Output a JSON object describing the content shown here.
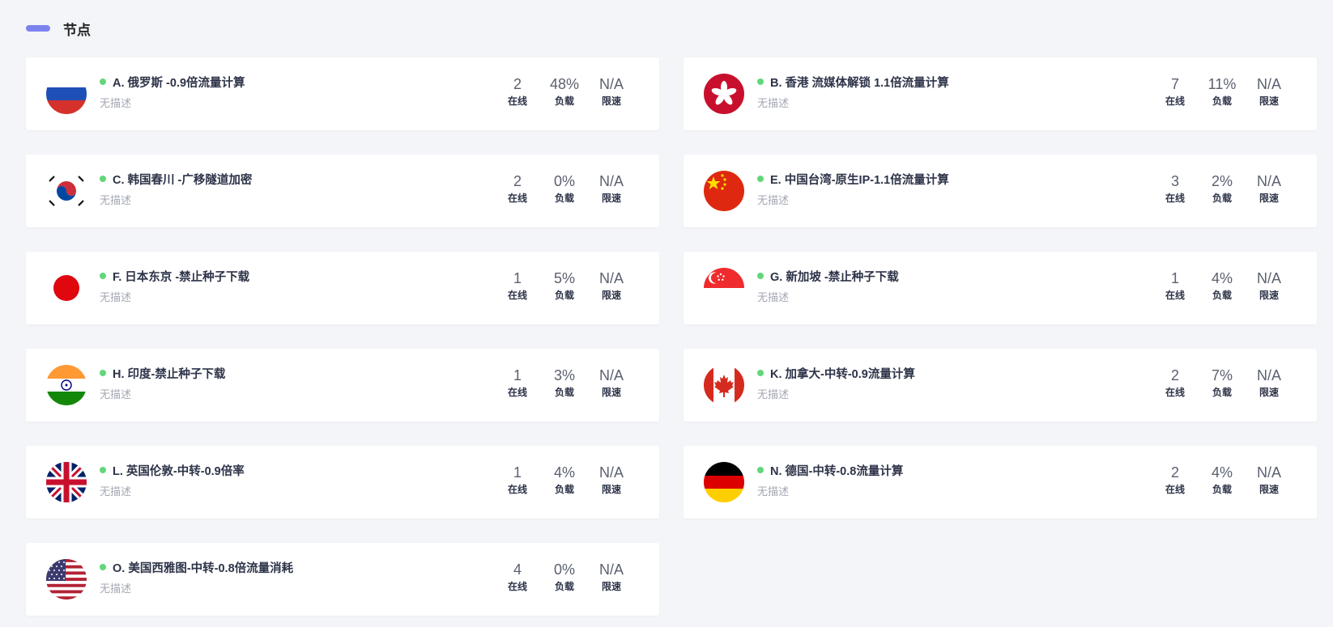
{
  "header": {
    "title": "节点"
  },
  "nodes": [
    {
      "flag": "russia-flag-icon",
      "name": "A. 俄罗斯 -0.9倍流量计算",
      "desc": "无描述",
      "online": "2",
      "load": "48%",
      "speed": "N/A",
      "online_label": "在线",
      "load_label": "负载",
      "speed_label": "限速"
    },
    {
      "flag": "hongkong-flag-icon",
      "name": "B. 香港 流媒体解锁 1.1倍流量计算",
      "desc": "无描述",
      "online": "7",
      "load": "11%",
      "speed": "N/A",
      "online_label": "在线",
      "load_label": "负载",
      "speed_label": "限速"
    },
    {
      "flag": "korea-flag-icon",
      "name": "C. 韩国春川 -广移隧道加密",
      "desc": "无描述",
      "online": "2",
      "load": "0%",
      "speed": "N/A",
      "online_label": "在线",
      "load_label": "负载",
      "speed_label": "限速"
    },
    {
      "flag": "china-flag-icon",
      "name": "E. 中国台湾-原生IP-1.1倍流量计算",
      "desc": "无描述",
      "online": "3",
      "load": "2%",
      "speed": "N/A",
      "online_label": "在线",
      "load_label": "负载",
      "speed_label": "限速"
    },
    {
      "flag": "japan-flag-icon",
      "name": "F. 日本东京 -禁止种子下载",
      "desc": "无描述",
      "online": "1",
      "load": "5%",
      "speed": "N/A",
      "online_label": "在线",
      "load_label": "负载",
      "speed_label": "限速"
    },
    {
      "flag": "singapore-flag-icon",
      "name": "G. 新加坡 -禁止种子下载",
      "desc": "无描述",
      "online": "1",
      "load": "4%",
      "speed": "N/A",
      "online_label": "在线",
      "load_label": "负载",
      "speed_label": "限速"
    },
    {
      "flag": "india-flag-icon",
      "name": "H. 印度-禁止种子下载",
      "desc": "无描述",
      "online": "1",
      "load": "3%",
      "speed": "N/A",
      "online_label": "在线",
      "load_label": "负载",
      "speed_label": "限速"
    },
    {
      "flag": "canada-flag-icon",
      "name": "K. 加拿大-中转-0.9流量计算",
      "desc": "无描述",
      "online": "2",
      "load": "7%",
      "speed": "N/A",
      "online_label": "在线",
      "load_label": "负载",
      "speed_label": "限速"
    },
    {
      "flag": "uk-flag-icon",
      "name": "L. 英国伦敦-中转-0.9倍率",
      "desc": "无描述",
      "online": "1",
      "load": "4%",
      "speed": "N/A",
      "online_label": "在线",
      "load_label": "负载",
      "speed_label": "限速"
    },
    {
      "flag": "germany-flag-icon",
      "name": "N. 德国-中转-0.8流量计算",
      "desc": "无描述",
      "online": "2",
      "load": "4%",
      "speed": "N/A",
      "online_label": "在线",
      "load_label": "负载",
      "speed_label": "限速"
    },
    {
      "flag": "usa-flag-icon",
      "name": "O. 美国西雅图-中转-0.8倍流量消耗",
      "desc": "无描述",
      "online": "4",
      "load": "0%",
      "speed": "N/A",
      "online_label": "在线",
      "load_label": "负载",
      "speed_label": "限速"
    }
  ],
  "colors": {
    "accent": "#7c83ef",
    "status_online": "#62d77a",
    "background": "#f4f5f8"
  }
}
